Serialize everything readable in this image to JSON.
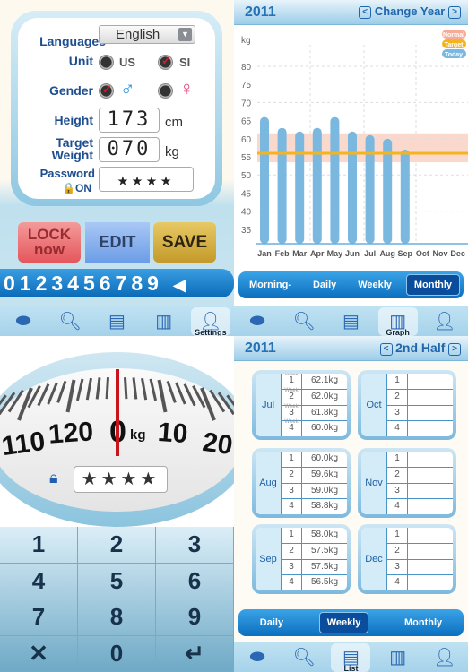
{
  "settings": {
    "languages_label": "Languages",
    "language_value": "English",
    "unit_label": "Unit",
    "unit_options": [
      "US",
      "SI"
    ],
    "unit_selected": "SI",
    "gender_label": "Gender",
    "gender_options": [
      "♂",
      "♀"
    ],
    "gender_selected": "♂",
    "height_label": "Height",
    "height_value": "173",
    "height_unit": "cm",
    "target_label_1": "Target",
    "target_label_2": "Weight",
    "target_value": "070",
    "target_unit": "kg",
    "password_label": "Password",
    "password_state": "ON",
    "password_mask": "★★★★",
    "buttons": {
      "lock_1": "LOCK",
      "lock_2": "now",
      "edit": "EDIT",
      "save": "SAVE"
    },
    "numbers": "0123456789",
    "backspace": "◀"
  },
  "tabs": [
    {
      "name": "scale",
      "label": ""
    },
    {
      "name": "search",
      "label": ""
    },
    {
      "name": "list",
      "label": "List"
    },
    {
      "name": "graph",
      "label": "Graph"
    },
    {
      "name": "settings",
      "label": "Settings"
    }
  ],
  "graph": {
    "year": "2011",
    "change_label": "Change Year",
    "prev": "<",
    "next": ">",
    "segments": [
      "Morning-",
      "Daily",
      "Weekly",
      "Monthly"
    ],
    "segment_selected": "Monthly"
  },
  "chart_data": {
    "type": "bar",
    "title": "",
    "ylabel": "kg",
    "xlabel": "",
    "categories": [
      "Jan",
      "Feb",
      "Mar",
      "Apr",
      "May",
      "Jun",
      "Jul",
      "Aug",
      "Sep",
      "Oct",
      "Nov",
      "Dec"
    ],
    "values": [
      66,
      63,
      62,
      63,
      66,
      62,
      61,
      60,
      57,
      null,
      null,
      null
    ],
    "ylim": [
      31,
      85
    ],
    "yticks": [
      35,
      40,
      45,
      50,
      55,
      60,
      65,
      70,
      75,
      80
    ],
    "target": 56,
    "normal_range": [
      53.5,
      61.5
    ],
    "legend": [
      "Normal",
      "Target",
      "Today"
    ],
    "legend_position": "top-right",
    "colors": {
      "bar": "#7ab8e0",
      "target": "#f5b41e",
      "normal": "#fbd8cc",
      "today": "#7ab8e0"
    },
    "grid": true
  },
  "scale": {
    "labels": [
      "110",
      "120",
      "0",
      "10",
      "20"
    ],
    "unit": "kg",
    "password_mask": "★★★★",
    "keys": [
      "1",
      "2",
      "3",
      "4",
      "5",
      "6",
      "7",
      "8",
      "9",
      "✕",
      "0",
      "↵"
    ]
  },
  "list": {
    "year": "2011",
    "period": "2nd Half",
    "prev": "<",
    "next": ">",
    "week_label": "Week",
    "months": [
      {
        "name": "Jul",
        "values": [
          "62.1kg",
          "62.0kg",
          "61.8kg",
          "60.0kg"
        ]
      },
      {
        "name": "Oct",
        "values": [
          "",
          "",
          "",
          ""
        ]
      },
      {
        "name": "Aug",
        "values": [
          "60.0kg",
          "59.6kg",
          "59.0kg",
          "58.8kg"
        ]
      },
      {
        "name": "Nov",
        "values": [
          "",
          "",
          "",
          ""
        ]
      },
      {
        "name": "Sep",
        "values": [
          "58.0kg",
          "57.5kg",
          "57.5kg",
          "56.5kg"
        ]
      },
      {
        "name": "Dec",
        "values": [
          "",
          "",
          "",
          ""
        ]
      }
    ],
    "segments": [
      "Daily",
      "Weekly",
      "Monthly"
    ],
    "segment_selected": "Weekly"
  }
}
